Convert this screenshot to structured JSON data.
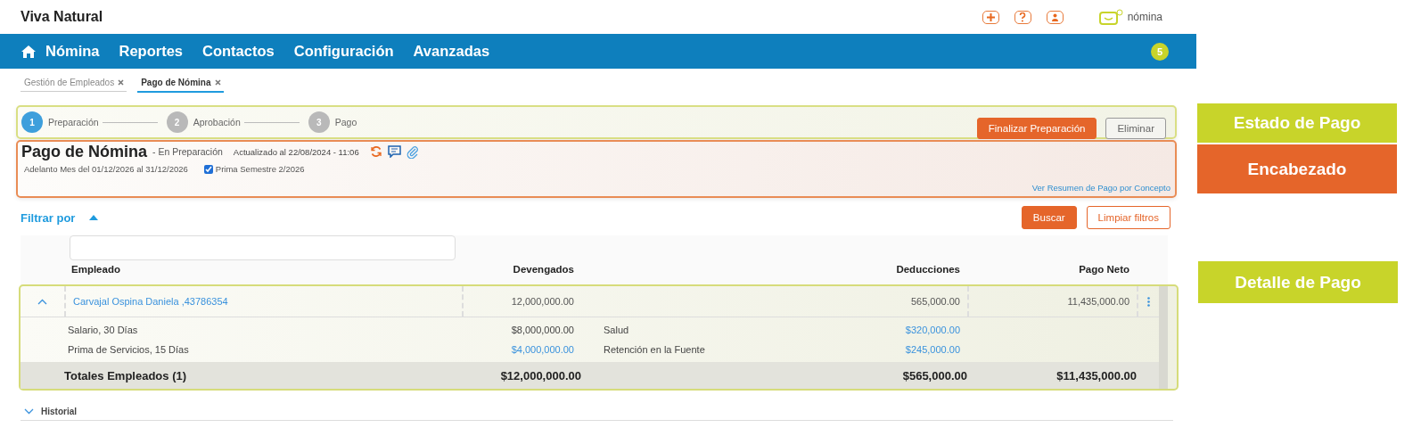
{
  "app": {
    "company": "Viva Natural",
    "brand": "nómina",
    "notification_count": "5"
  },
  "nav": [
    {
      "label": "Nómina",
      "kind": "home"
    },
    {
      "label": "Reportes",
      "kind": "plain"
    },
    {
      "label": "Contactos",
      "kind": "plain"
    },
    {
      "label": "Configuración",
      "kind": "plain"
    },
    {
      "label": "Avanzadas",
      "kind": "plain"
    }
  ],
  "tabs": [
    {
      "label": "Gestión de Empleados",
      "selected": false
    },
    {
      "label": "Pago de Nómina",
      "selected": true
    }
  ],
  "status": {
    "steps": [
      {
        "number": "1",
        "label": "Preparación",
        "selected": true
      },
      {
        "number": "2",
        "label": "Aprobación",
        "selected": false
      },
      {
        "number": "3",
        "label": "Pago",
        "selected": false
      }
    ],
    "actions": [
      {
        "label": "Finalizar Preparación",
        "kind": "primary"
      },
      {
        "label": "Eliminar",
        "kind": "secondary"
      }
    ],
    "callout": {
      "label": "Estado de Pago",
      "color": "#c8d42a"
    }
  },
  "header": {
    "title": "Pago de Nómina",
    "state": "- En Preparación",
    "updated": "Actualizado al 22/08/2024 - 11:06",
    "period": "Adelanto Mes del 01/12/2026 al 31/12/2026",
    "prima": {
      "label": "Prima Semestre 2/2026",
      "checked": true
    },
    "summary_link": "Ver Resumen de Pago por Concepto",
    "callout": {
      "label": "Encabezado",
      "color": "#e5652a"
    }
  },
  "filter": {
    "label": "Filtrar por",
    "expanded": true,
    "buttons": [
      {
        "label": "Buscar",
        "kind": "primary"
      },
      {
        "label": "Limpiar filtros",
        "kind": "outline"
      }
    ]
  },
  "table": {
    "columns": [
      "Empleado",
      "Devengados",
      "Deducciones",
      "Pago Neto"
    ],
    "rows": [
      {
        "employee": "Carvajal Ospina Daniela ,43786354",
        "expanded": true,
        "devengados": "12,000,000.00",
        "deducciones": "565,000.00",
        "pago_neto": "11,435,000.00",
        "earnings": [
          {
            "concept": "Salario, 30 Días",
            "amount": "$8,000,000.00",
            "link": false
          },
          {
            "concept": "Prima de Servicios, 15 Días",
            "amount": "$4,000,000.00",
            "link": true
          }
        ],
        "deductions": [
          {
            "concept": "Salud",
            "amount": "$320,000.00",
            "link": true
          },
          {
            "concept": "Retención en la Fuente",
            "amount": "$245,000.00",
            "link": true
          }
        ]
      }
    ],
    "totals": {
      "label": "Totales Empleados (1)",
      "devengados": "$12,000,000.00",
      "deducciones": "$565,000.00",
      "pago_neto": "$11,435,000.00"
    },
    "callout": {
      "label": "Detalle de Pago",
      "color": "#c8d42a"
    }
  },
  "history": {
    "label": "Historial",
    "expanded": false
  }
}
